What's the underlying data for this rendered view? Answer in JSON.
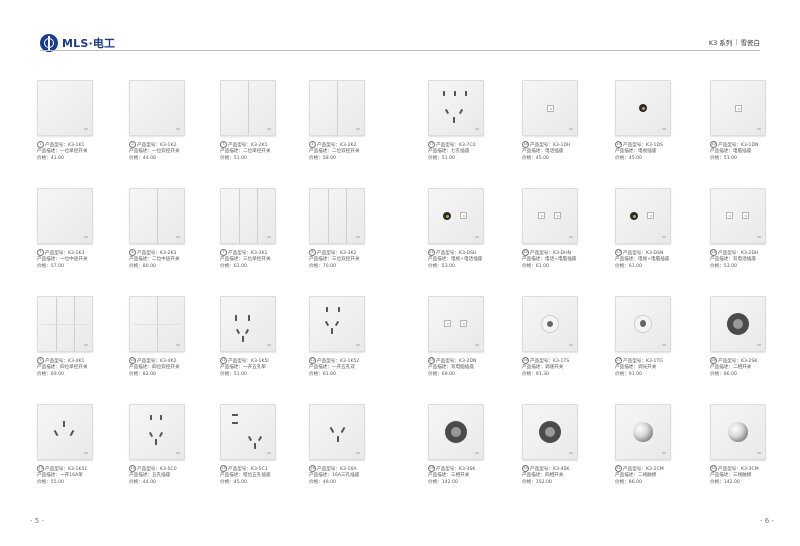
{
  "header": {
    "brand": "MLS·电工",
    "series": "K3 系列",
    "color_name": "雪瓷白"
  },
  "pages": {
    "left": "- 5 -",
    "right": "- 6 -"
  },
  "left_products": [
    {
      "num": "1",
      "model": "产品型号：K3-1K1",
      "desc": "产品描述：一位单控开关",
      "price": "价格：41.00"
    },
    {
      "num": "2",
      "model": "产品型号：K3-1K2",
      "desc": "产品描述：一位双控开关",
      "price": "价格：44.00"
    },
    {
      "num": "3",
      "model": "产品型号：K3-2K1",
      "desc": "产品描述：二位单控开关",
      "price": "价格：51.00"
    },
    {
      "num": "4",
      "model": "产品型号：K3-2K2",
      "desc": "产品描述：二位双控开关",
      "price": "价格：58.00"
    },
    {
      "num": "5",
      "model": "产品型号：K3-1K3",
      "desc": "产品描述：一位中途开关",
      "price": "价格：57.00"
    },
    {
      "num": "6",
      "model": "产品型号：K3-2K3",
      "desc": "产品描述：二位中途开关",
      "price": "价格：80.00"
    },
    {
      "num": "7",
      "model": "产品型号：K3-3K1",
      "desc": "产品描述：三位单控开关",
      "price": "价格：61.00"
    },
    {
      "num": "8",
      "model": "产品型号：K3-3K2",
      "desc": "产品描述：三位双控开关",
      "price": "价格：70.00"
    },
    {
      "num": "9",
      "model": "产品型号：K3-4K1",
      "desc": "产品描述：四位单控开关",
      "price": "价格：69.00"
    },
    {
      "num": "10",
      "model": "产品型号：K3-4K2",
      "desc": "产品描述：四位双控开关",
      "price": "价格：82.00"
    },
    {
      "num": "11",
      "model": "产品型号：K3-1K5I",
      "desc": "产品描述：一开五孔单",
      "price": "价格：51.00"
    },
    {
      "num": "12",
      "model": "产品型号：K3-1K52",
      "desc": "产品描述：一开五孔双",
      "price": "价格：61.00"
    },
    {
      "num": "13",
      "model": "产品型号：K3-1K51",
      "desc": "产品描述：一开16A单",
      "price": "价格：55.00"
    },
    {
      "num": "14",
      "model": "产品型号：K3-5C0",
      "desc": "产品描述：五孔插座",
      "price": "价格：44.00"
    },
    {
      "num": "15",
      "model": "产品型号：K3-5C1",
      "desc": "产品描述：错位五孔插座",
      "price": "价格：45.00"
    },
    {
      "num": "16",
      "model": "产品型号：K3-16A",
      "desc": "产品描述：16A三孔插座",
      "price": "价格：49.00"
    }
  ],
  "right_products": [
    {
      "num": "17",
      "model": "产品型号：K3-7C0",
      "desc": "产品描述：七孔插座",
      "price": "价格：51.00"
    },
    {
      "num": "18",
      "model": "产品型号：K3-1DH",
      "desc": "产品描述：电话插座",
      "price": "价格：45.00"
    },
    {
      "num": "19",
      "model": "产品型号：K3-1DS",
      "desc": "产品描述：电视插座",
      "price": "价格：45.00"
    },
    {
      "num": "20",
      "model": "产品型号：K3-1DN",
      "desc": "产品描述：电脑插座",
      "price": "价格：51.00"
    },
    {
      "num": "21",
      "model": "产品型号：K3-DSH",
      "desc": "产品描述：电视+电话插座",
      "price": "价格：53.00"
    },
    {
      "num": "22",
      "model": "产品型号：K3-DHN",
      "desc": "产品描述：电话+电脑插座",
      "price": "价格：61.00"
    },
    {
      "num": "23",
      "model": "产品型号：K3-DSN",
      "desc": "产品描述：电视+电脑插座",
      "price": "价格：61.00"
    },
    {
      "num": "24",
      "model": "产品型号：K3-2DH",
      "desc": "产品描述：双电话插座",
      "price": "价格：53.00"
    },
    {
      "num": "25",
      "model": "产品型号：K3-2DN",
      "desc": "产品描述：双电脑插座",
      "price": "价格：69.00"
    },
    {
      "num": "26",
      "model": "产品型号：K3-1TS",
      "desc": "产品描述：调速开关",
      "price": "价格：91.30"
    },
    {
      "num": "27",
      "model": "产品型号：K3-1TG",
      "desc": "产品描述：调光开关",
      "price": "价格：91.00"
    },
    {
      "num": "28",
      "model": "产品型号：K3-2SK",
      "desc": "产品描述：二相开关",
      "price": "价格：86.00"
    },
    {
      "num": "29",
      "model": "产品型号：K3-3SK",
      "desc": "产品描述：三相开关",
      "price": "价格：142.00"
    },
    {
      "num": "30",
      "model": "产品型号：K3-4SK",
      "desc": "产品描述：四相开关",
      "price": "价格：152.00"
    },
    {
      "num": "31",
      "model": "产品型号：K3-2CM",
      "desc": "产品描述：二线触摸",
      "price": "价格：86.00"
    },
    {
      "num": "32",
      "model": "产品型号：K3-3CM",
      "desc": "产品描述：三线触摸",
      "price": "价格：142.00"
    }
  ]
}
